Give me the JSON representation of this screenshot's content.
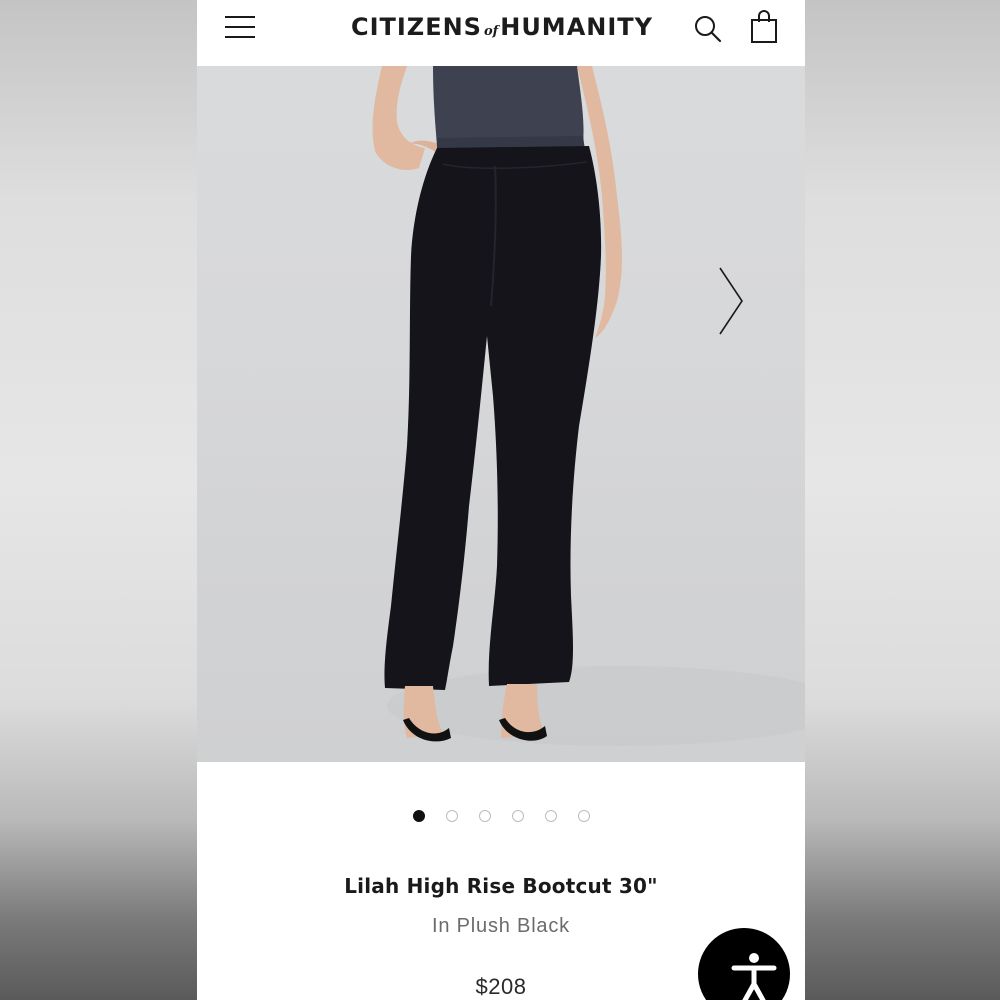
{
  "header": {
    "brand_left": "CITIZENS",
    "brand_of": "of",
    "brand_right": "HUMANITY",
    "menu_icon": "hamburger-menu-icon",
    "search_icon": "search-icon",
    "cart_icon": "shopping-bag-icon"
  },
  "gallery": {
    "next_icon": "chevron-right-icon",
    "slide_count": 6,
    "active_index": 0
  },
  "product": {
    "name": "Lilah High Rise Bootcut 30\"",
    "variant": "In Plush Black",
    "price": "$208"
  },
  "accessibility": {
    "icon": "accessibility-icon"
  },
  "colors": {
    "text_primary": "#1a1a1a",
    "text_secondary": "#6b6b6b",
    "dot_active": "#111111",
    "dot_inactive": "#bdbdbd",
    "background": "#ffffff"
  }
}
